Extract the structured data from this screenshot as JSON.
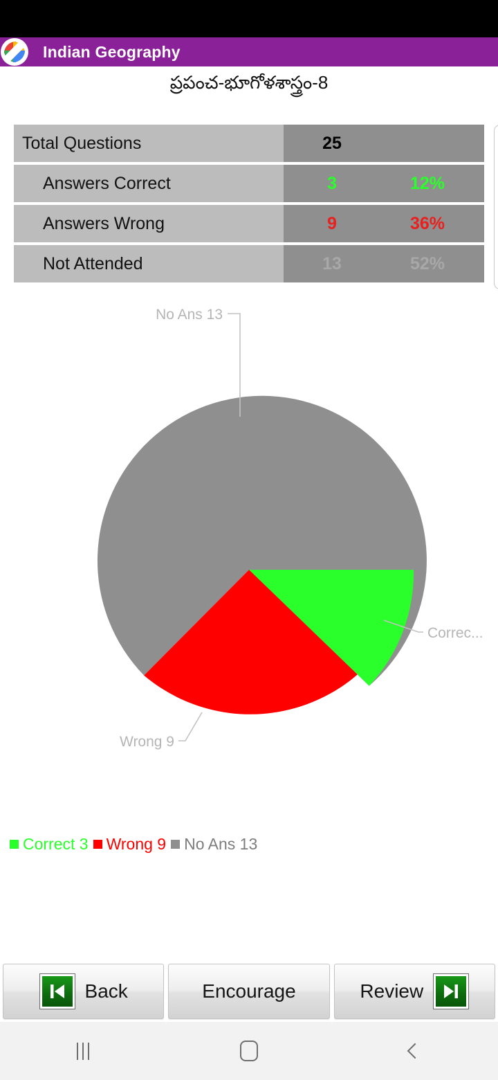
{
  "app": {
    "title": "Indian Geography",
    "icon_name": "app-logo-icon",
    "header_color": "#8b2199",
    "subtitle": "ప్రపంచ-భూగోళశాస్త్రం-8"
  },
  "stats": {
    "rows": [
      {
        "label": "Total Questions",
        "value": "25",
        "percent": "",
        "color": "#000000",
        "indent": false
      },
      {
        "label": "Answers Correct",
        "value": "3",
        "percent": "12%",
        "color": "#2bff2b",
        "indent": true
      },
      {
        "label": "Answers Wrong",
        "value": "9",
        "percent": "36%",
        "color": "#e8201f",
        "indent": true
      },
      {
        "label": "Not Attended",
        "value": "13",
        "percent": "52%",
        "color": "#a8a8a8",
        "indent": true
      }
    ]
  },
  "chart_data": {
    "type": "pie",
    "title": "",
    "categories": [
      "Correct",
      "Wrong",
      "No Ans"
    ],
    "values": [
      3,
      9,
      13
    ],
    "total": 25,
    "percents": [
      12,
      36,
      52
    ],
    "colors": [
      "#2bff2b",
      "#fe0000",
      "#8f8f8f"
    ],
    "slice_labels": [
      "Correc...",
      "Wrong 9",
      "No Ans 13"
    ],
    "legend": [
      {
        "label": "Correct 3",
        "color": "#2bff2b"
      },
      {
        "label": "Wrong 9",
        "color": "#fe0000"
      },
      {
        "label": "No Ans 13",
        "color": "#8f8f8f"
      }
    ],
    "legend_position": "bottom-left",
    "start_angle_deg": 0,
    "direction": "clockwise",
    "grid": false
  },
  "buttons": {
    "back": {
      "label": "Back",
      "icon": "skip-to-start-icon"
    },
    "encourage": {
      "label": "Encourage",
      "icon": ""
    },
    "review": {
      "label": "Review",
      "icon": "skip-to-end-icon"
    }
  },
  "android_nav": {
    "recents": "recents-icon",
    "home": "home-icon",
    "back": "back-icon"
  }
}
